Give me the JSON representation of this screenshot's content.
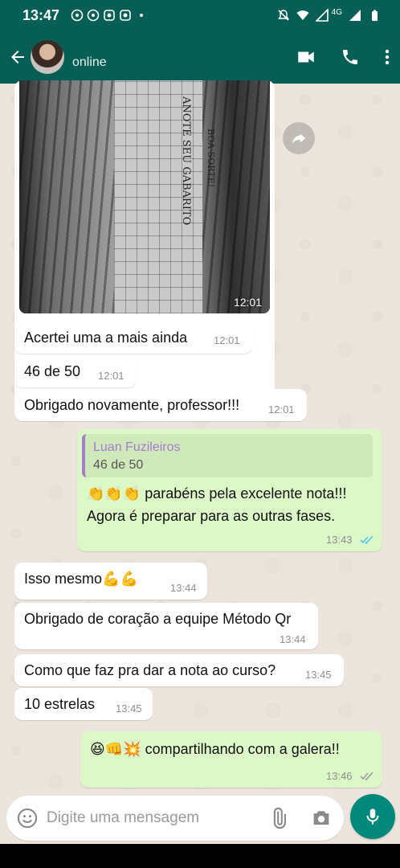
{
  "status_bar": {
    "time": "13:47",
    "network": "4G"
  },
  "header": {
    "contact_status": "online"
  },
  "messages": [
    {
      "dir": "in",
      "type": "image",
      "time": "12:01",
      "photo_text_1": "ANOTE SEU GABARITO",
      "photo_text_2": "BOA SORTE!"
    },
    {
      "dir": "in",
      "text": "Acertei uma a mais ainda",
      "time": "12:01"
    },
    {
      "dir": "in",
      "text": "46 de 50",
      "time": "12:01"
    },
    {
      "dir": "in",
      "text": "Obrigado novamente, professor!!!",
      "time": "12:01"
    },
    {
      "dir": "out",
      "quote_author": "Luan Fuzileiros",
      "quote_text": "46 de 50",
      "emoji": "👏👏👏",
      "text_line1": "parabéns pela excelente nota!!!",
      "text_line2": "Agora é preparar para as outras fases.",
      "time": "13:43",
      "status": "read"
    },
    {
      "dir": "in",
      "text": "Isso mesmo",
      "emoji": "💪💪",
      "time": "13:44"
    },
    {
      "dir": "in",
      "text": "Obrigado de coração a equipe Método Qr",
      "time": "13:44"
    },
    {
      "dir": "in",
      "text": "Como que faz pra dar a nota ao curso?",
      "time": "13:45"
    },
    {
      "dir": "in",
      "text": "10 estrelas",
      "time": "13:45"
    },
    {
      "dir": "out",
      "emoji": "😆👊💥",
      "text": "compartilhando com a galera!!",
      "time": "13:46",
      "status": "delivered"
    }
  ],
  "composer": {
    "placeholder": "Digite uma mensagem"
  },
  "colors": {
    "header": "#075e54",
    "chat_bg": "#ece5dd",
    "incoming": "#ffffff",
    "outgoing": "#dcf8c6",
    "mic_button": "#00897b",
    "read_ticks": "#4fc3f7"
  },
  "icons": [
    "back-arrow-icon",
    "video-call-icon",
    "phone-icon",
    "more-options-icon",
    "forward-icon",
    "emoji-icon",
    "attach-icon",
    "camera-icon",
    "mic-icon"
  ]
}
